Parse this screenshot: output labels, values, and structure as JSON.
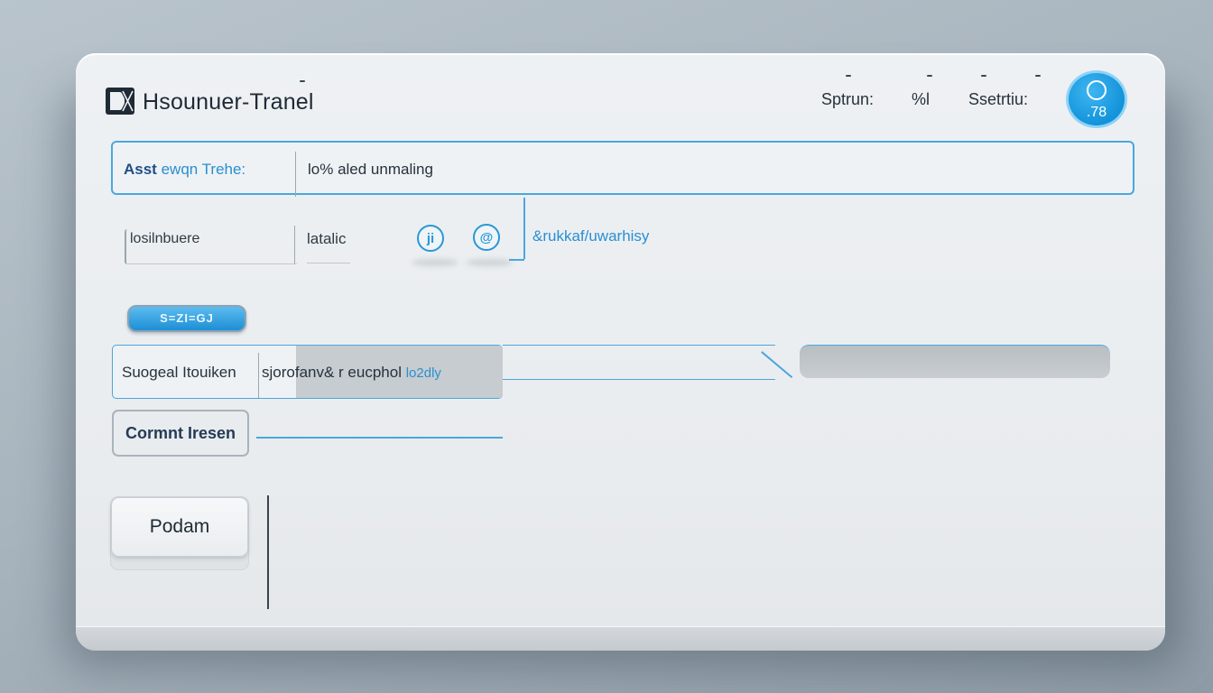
{
  "header": {
    "title": "Hsounuer-Tranel",
    "logo_icon": "dx-logo-icon",
    "menu": [
      "Sptrun:",
      "%l",
      "Ssetrtiu:"
    ],
    "avatar": {
      "badge": ".78"
    }
  },
  "row1": {
    "label_strong": "Asst",
    "label_rest": "ewqn Trehe:",
    "value": "lo% aled unmaling"
  },
  "row2": {
    "field_value": "losilnbuere",
    "value": "latalic",
    "icon1": "ji",
    "icon2": "@",
    "link": "&rukkaf/uwarhisy"
  },
  "pill_button": {
    "label": "S=ZI=GJ"
  },
  "row3": {
    "label": "Suogeal Itouiken",
    "value": "sjorofanv& r eucphol",
    "value_blue": "lo2dly"
  },
  "comment_button": {
    "label": "Cormnt Iresen"
  },
  "primary_button": {
    "label": "Podam"
  },
  "colors": {
    "accent": "#2a98d6",
    "border": "#4aa7dc",
    "avatar": "#1393da"
  }
}
